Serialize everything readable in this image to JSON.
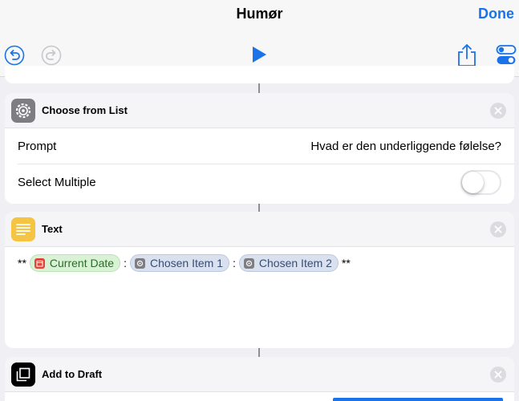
{
  "header": {
    "title": "Humør",
    "done_label": "Done"
  },
  "icons": {
    "undo": "undo-icon",
    "redo": "redo-icon",
    "play": "play-icon",
    "share": "share-icon",
    "settings": "settings-toggle-icon"
  },
  "colors": {
    "accent": "#1a73e8",
    "text_icon": "#f6c443",
    "date_token": "#d9f2d6",
    "item_token": "#d9e0ee"
  },
  "choose_from_list": {
    "name": "Choose from List",
    "prompt_label": "Prompt",
    "prompt_value": "Hvad er den underliggende følelse?",
    "select_multiple_label": "Select Multiple",
    "select_multiple_on": false
  },
  "text_action": {
    "name": "Text",
    "prefix": "**",
    "token_current_date": "Current Date",
    "separator_1": ":",
    "token_chosen_item_1": "Chosen Item 1",
    "separator_2": ":",
    "token_chosen_item_2": "Chosen Item 2",
    "suffix": "**"
  },
  "add_to_draft": {
    "name": "Add to Draft"
  }
}
